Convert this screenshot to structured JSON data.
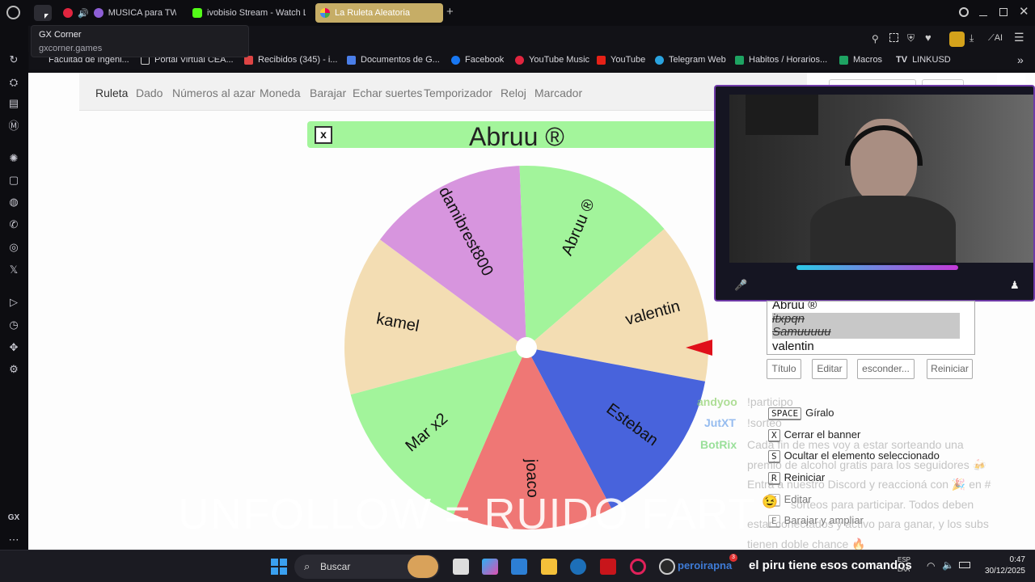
{
  "tabs": [
    {
      "label": "MUSICA para TWIT"
    },
    {
      "label": "ivobisio Stream - Watch L"
    },
    {
      "label": "La Ruleta Aleatoria"
    }
  ],
  "tooltip": {
    "title": "GX Corner",
    "url": "gxcorner.games"
  },
  "toolbar": {
    "ai_label": "AI"
  },
  "bookmarks": [
    {
      "label": "Facultad de Ingeni..."
    },
    {
      "label": "Portal Virtual CEA..."
    },
    {
      "label": "Recibidos (345) - i..."
    },
    {
      "label": "Documentos de G..."
    },
    {
      "label": "Facebook"
    },
    {
      "label": "YouTube Music"
    },
    {
      "label": "YouTube"
    },
    {
      "label": "Telegram Web"
    },
    {
      "label": "Habitos / Horarios..."
    },
    {
      "label": "Macros"
    },
    {
      "label": "LINKUSD"
    }
  ],
  "sidebar_gx_label": "GX",
  "nav": [
    "Ruleta",
    "Dado",
    "Números al azar",
    "Moneda",
    "Barajar",
    "Echar suertes",
    "Temporizador",
    "Reloj",
    "Marcador"
  ],
  "banner": {
    "close": "x",
    "title": "Abruu ®"
  },
  "wheel": {
    "segments": [
      {
        "label": "kamel",
        "color": "#f3ddb3"
      },
      {
        "label": "damibrest800",
        "color": "#d795de"
      },
      {
        "label": "Abruu ®",
        "color": "#a2f49b"
      },
      {
        "label": "valentin",
        "color": "#f3ddb3"
      },
      {
        "label": "Esteban",
        "color": "#4863dc"
      },
      {
        "label": "joaco",
        "color": "#ef7775"
      },
      {
        "label": "Mar x2",
        "color": "#a2f49b"
      }
    ],
    "pointer_color": "#e0101a"
  },
  "entries": {
    "items": [
      {
        "label": "Abruu ®",
        "struck": false
      },
      {
        "label": "itxpqn",
        "struck": true
      },
      {
        "label": "Samuuuuu",
        "struck": true
      },
      {
        "label": "valentin",
        "struck": false
      }
    ]
  },
  "buttons": {
    "title": "Título",
    "edit": "Editar",
    "hide": "esconder...",
    "reset": "Reiniciar"
  },
  "shortcuts": [
    {
      "key": "SPACE",
      "label": "Gíralo"
    },
    {
      "key": "X",
      "label": "Cerrar el banner"
    },
    {
      "key": "S",
      "label": "Ocultar el elemento seleccionado"
    },
    {
      "key": "R",
      "label": "Reiniciar"
    },
    {
      "key": "E",
      "label": "Editar"
    },
    {
      "key": "E",
      "label": "Barajar y ampliar"
    }
  ],
  "chat": [
    {
      "user": "andyoo",
      "message": "!participo",
      "color": "#8bd06a"
    },
    {
      "user": "JutXT",
      "message": "!sorteo",
      "color": "#6aa0e8"
    },
    {
      "user": "BotRix",
      "message": "Cada fin de mes voy a estar sorteando una",
      "color": "#6fd36f"
    }
  ],
  "chat_continuation": [
    "premio de alcohol gratis para los seguidores 🍻",
    "Entrá a nuestro Discord y reaccioná con 🎉 en #",
    "sorteos para participar. Todos deben",
    "estar conectados y activo para ganar, y los subs",
    "tienen doble chance 🔥"
  ],
  "overlay_big_text": "UNFOLLOW = RUIDO FART",
  "taskbar": {
    "search_placeholder": "Buscar",
    "chat_ticker": "peroirapna",
    "chat_ticker2": "el piru tiene esos comandos",
    "lang": "ESP\nLAA",
    "time": "0:47",
    "date": "30/12/2025",
    "badge": "3"
  }
}
